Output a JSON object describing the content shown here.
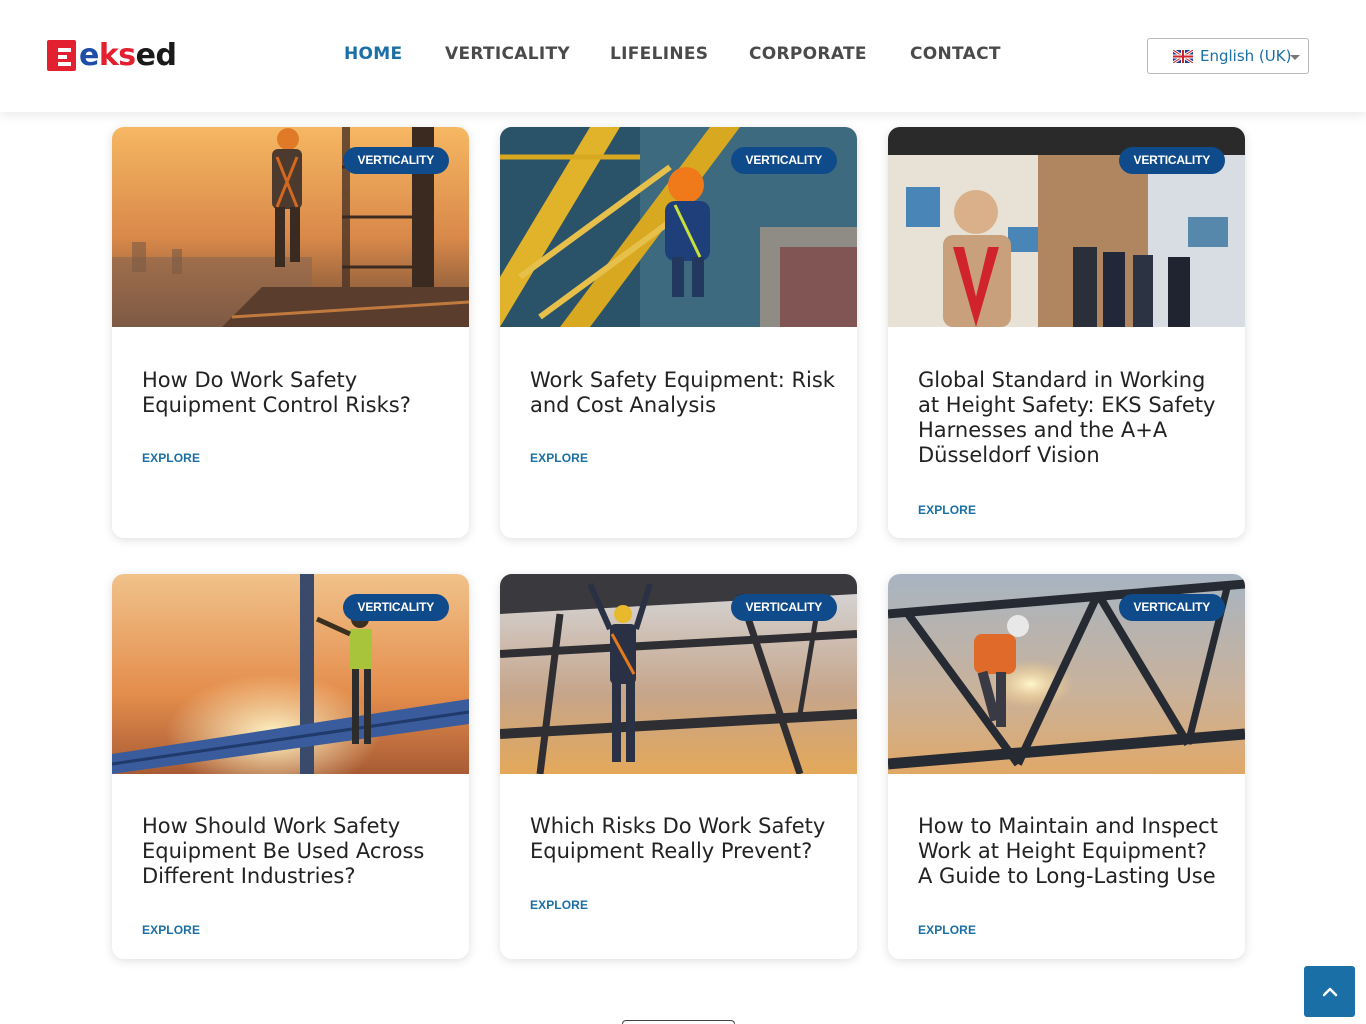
{
  "brand": {
    "logo_text_e": "e",
    "logo_text_ks": "ks",
    "logo_text_ed": "ed"
  },
  "nav": {
    "items": [
      {
        "label": "HOME",
        "active": true
      },
      {
        "label": "VERTICALITY",
        "active": false
      },
      {
        "label": "LIFELINES",
        "active": false
      },
      {
        "label": "CORPORATE",
        "active": false
      },
      {
        "label": "CONTACT",
        "active": false
      }
    ]
  },
  "language": {
    "selected": "English (UK)"
  },
  "cards": [
    {
      "badge": "VERTICALITY",
      "title": "How Do Work Safety Equipment Control Risks?",
      "cta": "EXPLORE",
      "image": "worker-climbing-tower-sunset"
    },
    {
      "badge": "VERTICALITY",
      "title": "Work Safety Equipment: Risk and Cost Analysis",
      "cta": "EXPLORE",
      "image": "worker-on-crane-aerial"
    },
    {
      "badge": "VERTICALITY",
      "title": "Global Standard in Working at Height Safety: EKS Safety Harnesses and the A+A Düsseldorf Vision",
      "cta": "EXPLORE",
      "image": "eksed-trade-fair-booth"
    },
    {
      "badge": "VERTICALITY",
      "title": "How Should Work Safety Equipment Be Used Across Different Industries?",
      "cta": "EXPLORE",
      "image": "worker-on-beam-sunset"
    },
    {
      "badge": "VERTICALITY",
      "title": "Which Risks Do Work Safety Equipment Really Prevent?",
      "cta": "EXPLORE",
      "image": "worker-on-steel-frame"
    },
    {
      "badge": "VERTICALITY",
      "title": "How to Maintain and Inspect Work at Height Equipment? A Guide to Long-Lasting Use",
      "cta": "EXPLORE",
      "image": "welder-on-truss"
    }
  ],
  "colors": {
    "accent": "#1a6fa6",
    "badge": "#0f4b8a",
    "brand_red": "#e3202f",
    "brand_blue": "#1e4ea8"
  },
  "icons": {
    "scroll_top": "chevron-up-icon",
    "flag": "uk-flag-icon",
    "dropdown": "caret-down-icon"
  }
}
